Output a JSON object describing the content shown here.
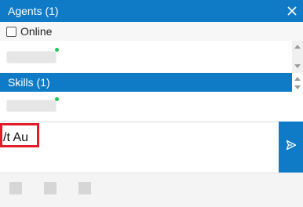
{
  "agents_panel": {
    "header_title": "Agents (1)",
    "close_icon": "close-icon",
    "online_filter": {
      "label": "Online",
      "checked": false
    },
    "agent_chips": [
      {
        "status": "online",
        "status_color": "#22c55e"
      }
    ]
  },
  "skills_panel": {
    "header_title": "Skills (1)",
    "skill_chips": [
      {
        "status": "online",
        "status_color": "#22c55e"
      }
    ]
  },
  "compose": {
    "value": "/t Au",
    "send_icon": "send-icon"
  },
  "toolbar": {
    "buttons": [
      "toolbar-button-1",
      "toolbar-button-2",
      "toolbar-button-3"
    ]
  },
  "colors": {
    "accent": "#0f7bc6",
    "highlight": "#e11d2a",
    "online": "#22c55e"
  }
}
